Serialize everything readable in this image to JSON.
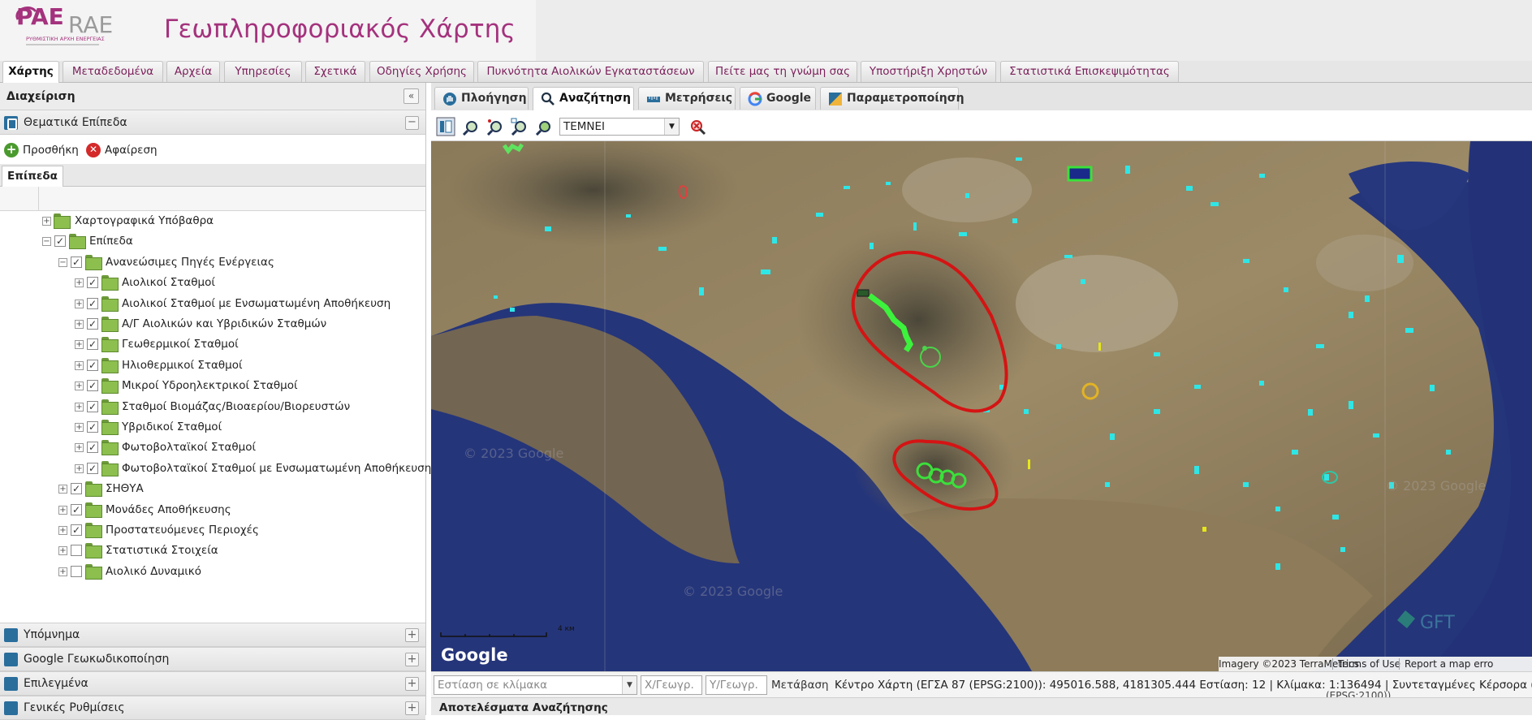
{
  "header": {
    "logo_text_pae": "PAE",
    "logo_text_rae": "RAE",
    "logo_subtitle": "ΡΥΘΜΙΣΤΙΚΗ ΑΡΧΗ ΕΝΕΡΓΕΙΑΣ",
    "title": "Γεωπληροφοριακός Χάρτης",
    "accent_color": "#a4327d"
  },
  "main_menu": {
    "items": [
      {
        "label": "Χάρτης",
        "active": true
      },
      {
        "label": "Μεταδεδομένα"
      },
      {
        "label": "Αρχεία"
      },
      {
        "label": "Υπηρεσίες"
      },
      {
        "label": "Σχετικά"
      },
      {
        "label": "Οδηγίες Χρήσης"
      },
      {
        "label": "Πυκνότητα Αιολικών Εγκαταστάσεων"
      },
      {
        "label": "Πείτε μας τη γνώμη σας"
      },
      {
        "label": "Υποστήριξη Χρηστών"
      },
      {
        "label": "Στατιστικά Επισκεψιμότητας"
      }
    ]
  },
  "left_panel": {
    "title": "Διαχείριση",
    "collapse_icon": "double-chevron-left",
    "thematic_layers": "Θεματικά Επίπεδα",
    "add_label": "Προσθήκη",
    "remove_label": "Αφαίρεση",
    "layers_tab": "Επίπεδα",
    "tree": [
      {
        "label": "Χαρτογραφικά Υπόβαθρα",
        "level": 0,
        "expander": "+",
        "checkbox": null
      },
      {
        "label": "Επίπεδα",
        "level": 0,
        "expander": "−",
        "checkbox": true
      },
      {
        "label": "Ανανεώσιμες Πηγές Ενέργειας",
        "level": 1,
        "expander": "−",
        "checkbox": true
      },
      {
        "label": "Αιολικοί Σταθμοί",
        "level": 2,
        "expander": "+",
        "checkbox": true
      },
      {
        "label": "Αιολικοί Σταθμοί με Ενσωματωμένη Αποθήκευση",
        "level": 2,
        "expander": "+",
        "checkbox": true
      },
      {
        "label": "Α/Γ Αιολικών και Υβριδικών Σταθμών",
        "level": 2,
        "expander": "+",
        "checkbox": true
      },
      {
        "label": "Γεωθερμικοί Σταθμοί",
        "level": 2,
        "expander": "+",
        "checkbox": true
      },
      {
        "label": "Ηλιοθερμικοί Σταθμοί",
        "level": 2,
        "expander": "+",
        "checkbox": true
      },
      {
        "label": "Μικροί Υδροηλεκτρικοί Σταθμοί",
        "level": 2,
        "expander": "+",
        "checkbox": true
      },
      {
        "label": "Σταθμοί Βιομάζας/Βιοαερίου/Βιορευστών",
        "level": 2,
        "expander": "+",
        "checkbox": true
      },
      {
        "label": "Υβριδικοί Σταθμοί",
        "level": 2,
        "expander": "+",
        "checkbox": true
      },
      {
        "label": "Φωτοβολταϊκοί Σταθμοί",
        "level": 2,
        "expander": "+",
        "checkbox": true
      },
      {
        "label": "Φωτοβολταϊκοί Σταθμοί με Ενσωματωμένη Αποθήκευση",
        "level": 2,
        "expander": "+",
        "checkbox": true
      },
      {
        "label": "ΣΗΘΥΑ",
        "level": 1,
        "expander": "+",
        "checkbox": true
      },
      {
        "label": "Μονάδες Αποθήκευσης",
        "level": 1,
        "expander": "+",
        "checkbox": true
      },
      {
        "label": "Προστατευόμενες Περιοχές",
        "level": 1,
        "expander": "+",
        "checkbox": true
      },
      {
        "label": "Στατιστικά Στοιχεία",
        "level": 1,
        "expander": "+",
        "checkbox": false
      },
      {
        "label": "Αιολικό Δυναμικό",
        "level": 1,
        "expander": "+",
        "checkbox": false
      }
    ],
    "bottom_sections": [
      "Υπόμνημα",
      "Google Γεωκωδικοποίηση",
      "Επιλεγμένα",
      "Γενικές Ρυθμίσεις"
    ]
  },
  "map_tabs": [
    {
      "label": "Πλοήγηση",
      "icon": "hand-icon"
    },
    {
      "label": "Αναζήτηση",
      "icon": "magnifier-icon",
      "active": true
    },
    {
      "label": "Μετρήσεις",
      "icon": "ruler-icon"
    },
    {
      "label": "Google",
      "icon": "google-icon"
    },
    {
      "label": "Παραμετροποίηση",
      "icon": "settings-icon"
    }
  ],
  "toolbar": {
    "selected_layer": "ΤΕΜΝΕΙ",
    "tools": [
      "identify-icon",
      "zoom-search-icon",
      "zoom-point-icon",
      "zoom-box-icon",
      "zoom-polygon-icon",
      "clear-search-icon"
    ]
  },
  "map": {
    "scale_label": "4 км",
    "google_logo": "Google",
    "watermark": "© 2023 Google",
    "imagery": "Imagery ©2023 TerraMetrics",
    "terms": "Terms of Use",
    "report": "Report a map erro",
    "gft_label": "GFT"
  },
  "status_bar": {
    "scale_placeholder": "Εστίαση σε κλίμακα",
    "x_placeholder": "X/Γεωγρ.",
    "y_placeholder": "Y/Γεωγρ.",
    "goto": "Μετάβαση",
    "info": "Κέντρο Χάρτη (ΕΓΣΑ 87 (EPSG:2100)): 495016.588, 4181305.444 Εστίαση: 12 | Κλίμακα: 1:136494 | Συντεταγμένες Κέρσορα (ΕΓΣΑ 87",
    "info_cont": "(EPSG:2100))"
  },
  "results": {
    "title": "Αποτελέσματα Αναζήτησης"
  }
}
